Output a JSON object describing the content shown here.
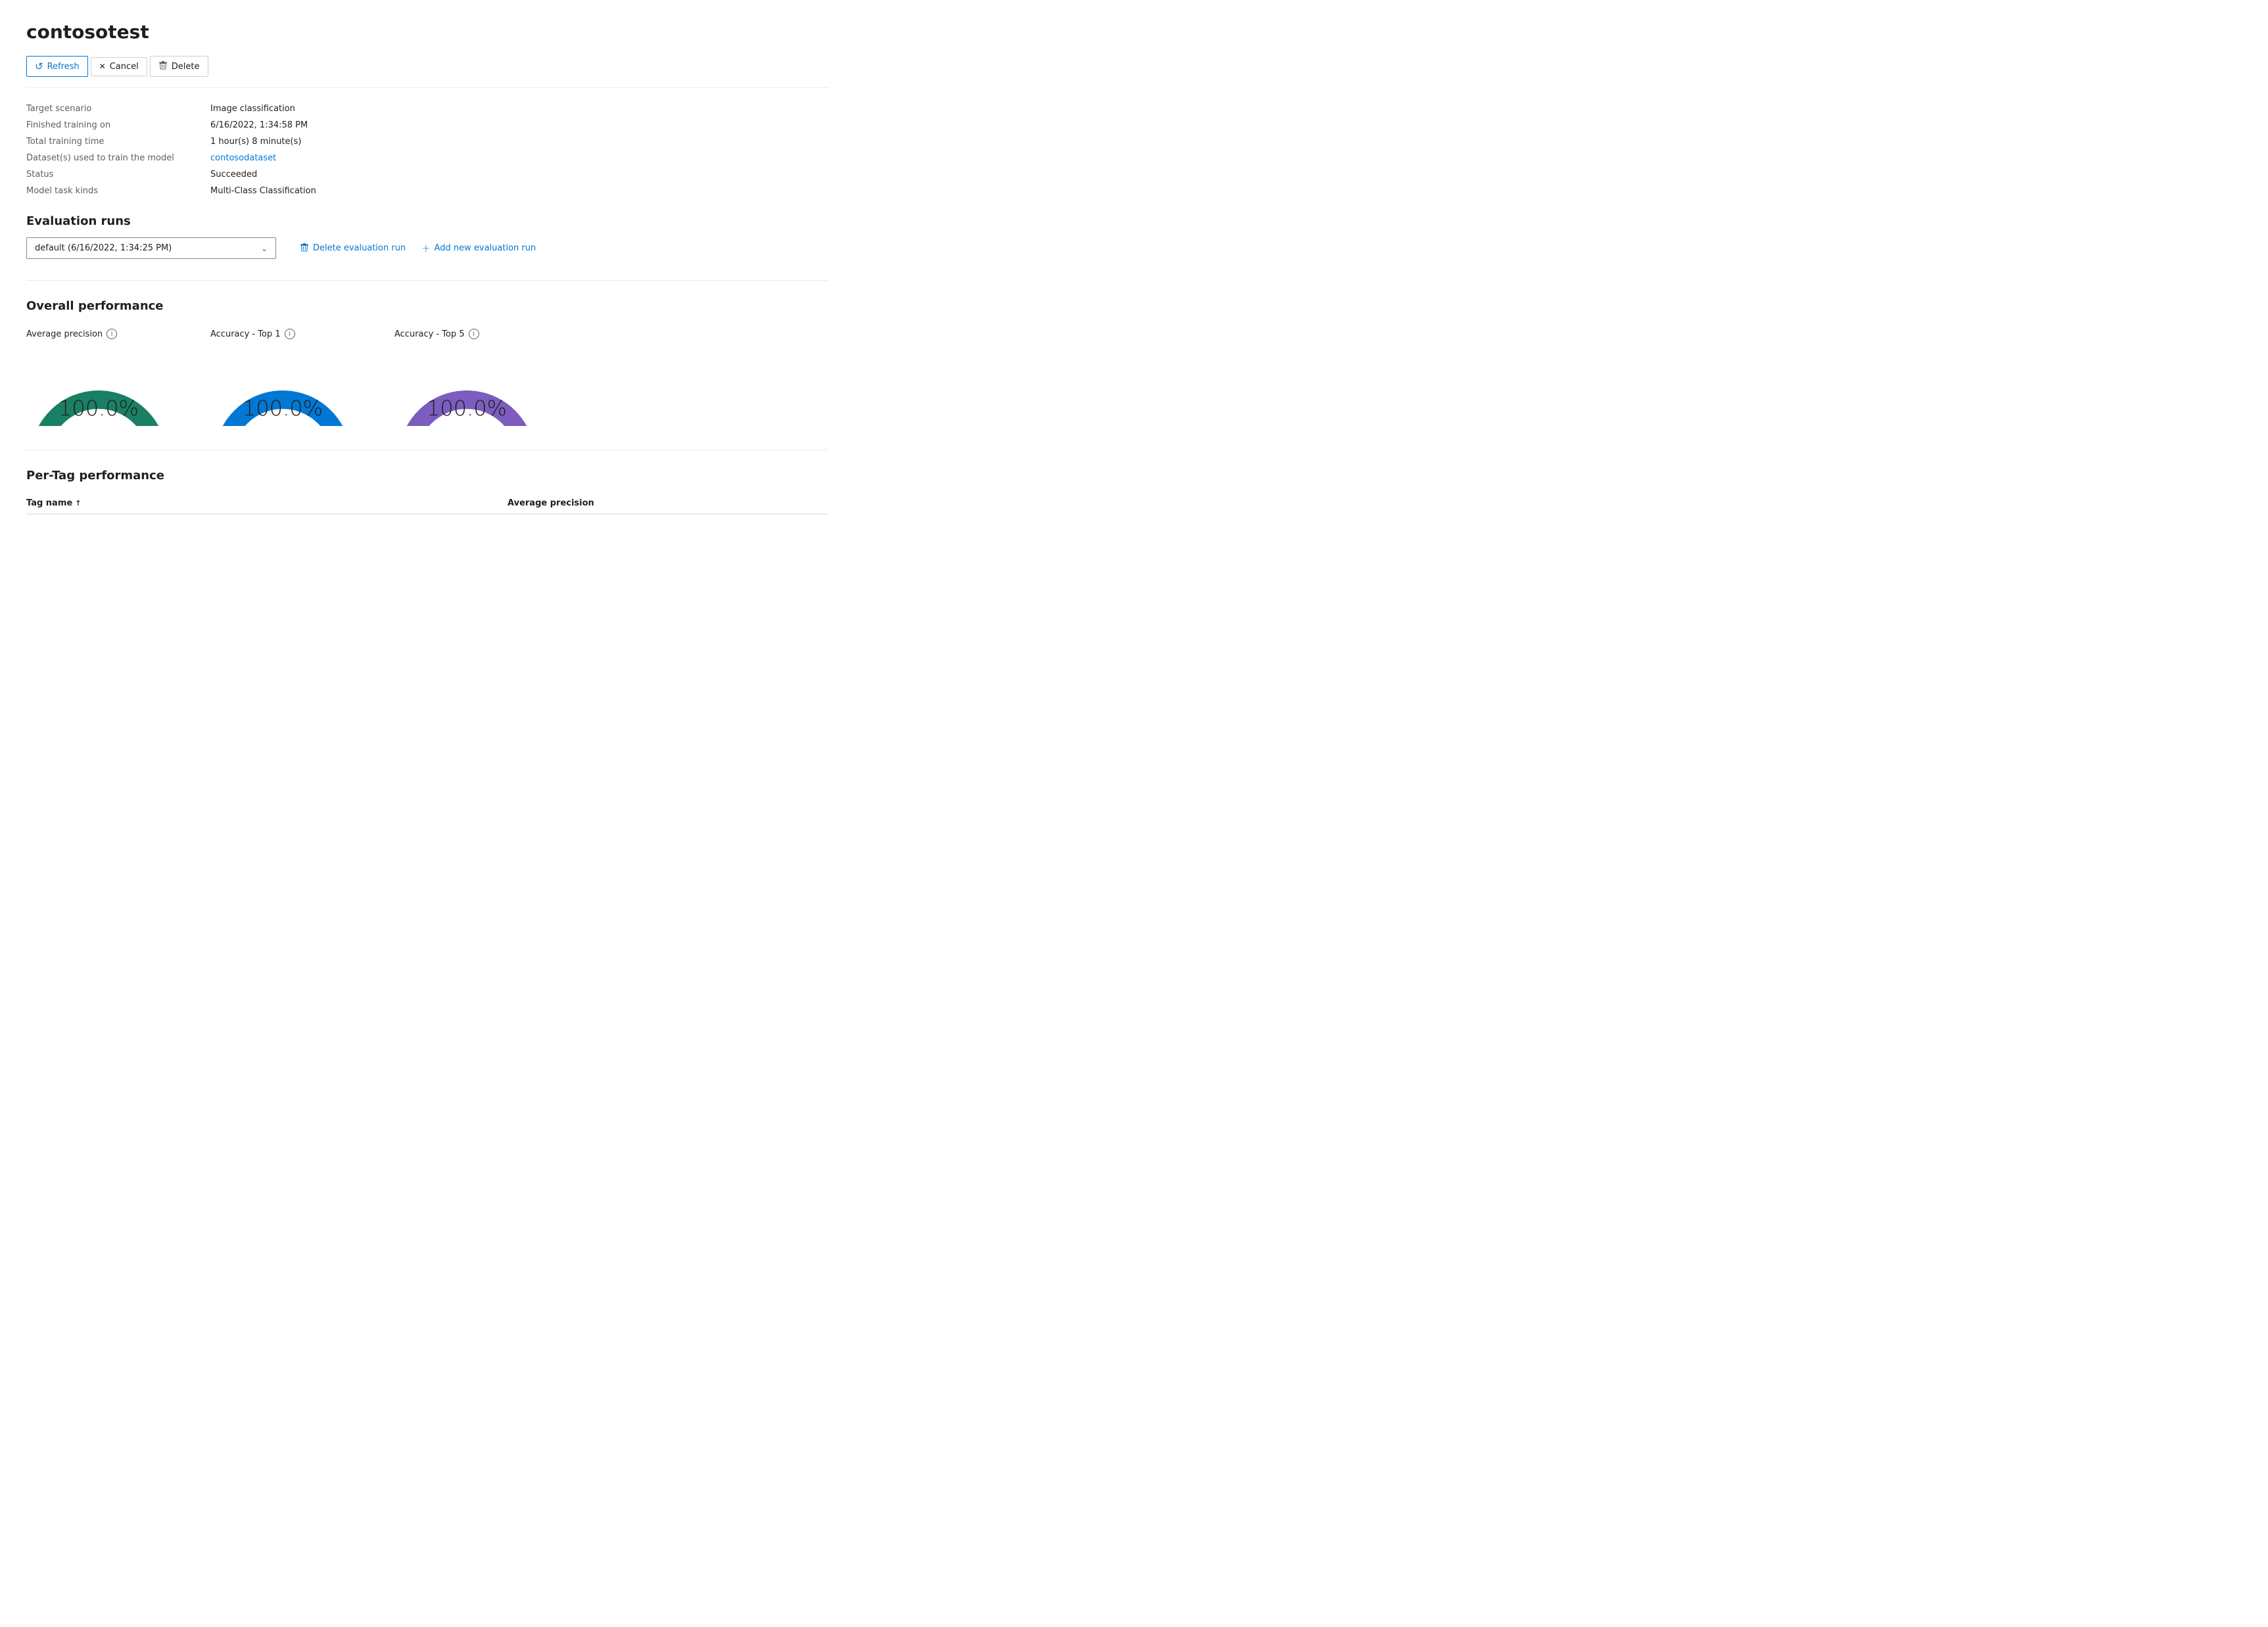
{
  "page": {
    "title": "contosotest"
  },
  "toolbar": {
    "refresh_label": "Refresh",
    "cancel_label": "Cancel",
    "delete_label": "Delete"
  },
  "info": {
    "fields": [
      {
        "label": "Target scenario",
        "value": "Image classification",
        "type": "text"
      },
      {
        "label": "Finished training on",
        "value": "6/16/2022, 1:34:58 PM",
        "type": "text"
      },
      {
        "label": "Total training time",
        "value": "1 hour(s) 8 minute(s)",
        "type": "text"
      },
      {
        "label": "Dataset(s) used to train the model",
        "value": "contosodataset",
        "type": "link"
      },
      {
        "label": "Status",
        "value": "Succeeded",
        "type": "text"
      },
      {
        "label": "Model task kinds",
        "value": "Multi-Class Classification",
        "type": "text"
      }
    ]
  },
  "evaluation_runs": {
    "section_title": "Evaluation runs",
    "dropdown_value": "default (6/16/2022, 1:34:25 PM)",
    "delete_label": "Delete evaluation run",
    "add_label": "Add new evaluation run"
  },
  "overall_performance": {
    "section_title": "Overall performance",
    "gauges": [
      {
        "label": "Average precision",
        "value": "100.0%",
        "color": "#1a7f64"
      },
      {
        "label": "Accuracy - Top 1",
        "value": "100.0%",
        "color": "#0078d4"
      },
      {
        "label": "Accuracy - Top 5",
        "value": "100.0%",
        "color": "#7c5cbf"
      }
    ]
  },
  "per_tag_performance": {
    "section_title": "Per-Tag performance",
    "columns": [
      {
        "label": "Tag name",
        "sortable": true,
        "sort_dir": "asc"
      },
      {
        "label": "Average precision",
        "sortable": false
      }
    ]
  },
  "icons": {
    "refresh": "↺",
    "cancel": "✕",
    "delete": "🗑",
    "chevron_down": "⌄",
    "plus": "+",
    "info": "i",
    "sort_asc": "↑"
  }
}
